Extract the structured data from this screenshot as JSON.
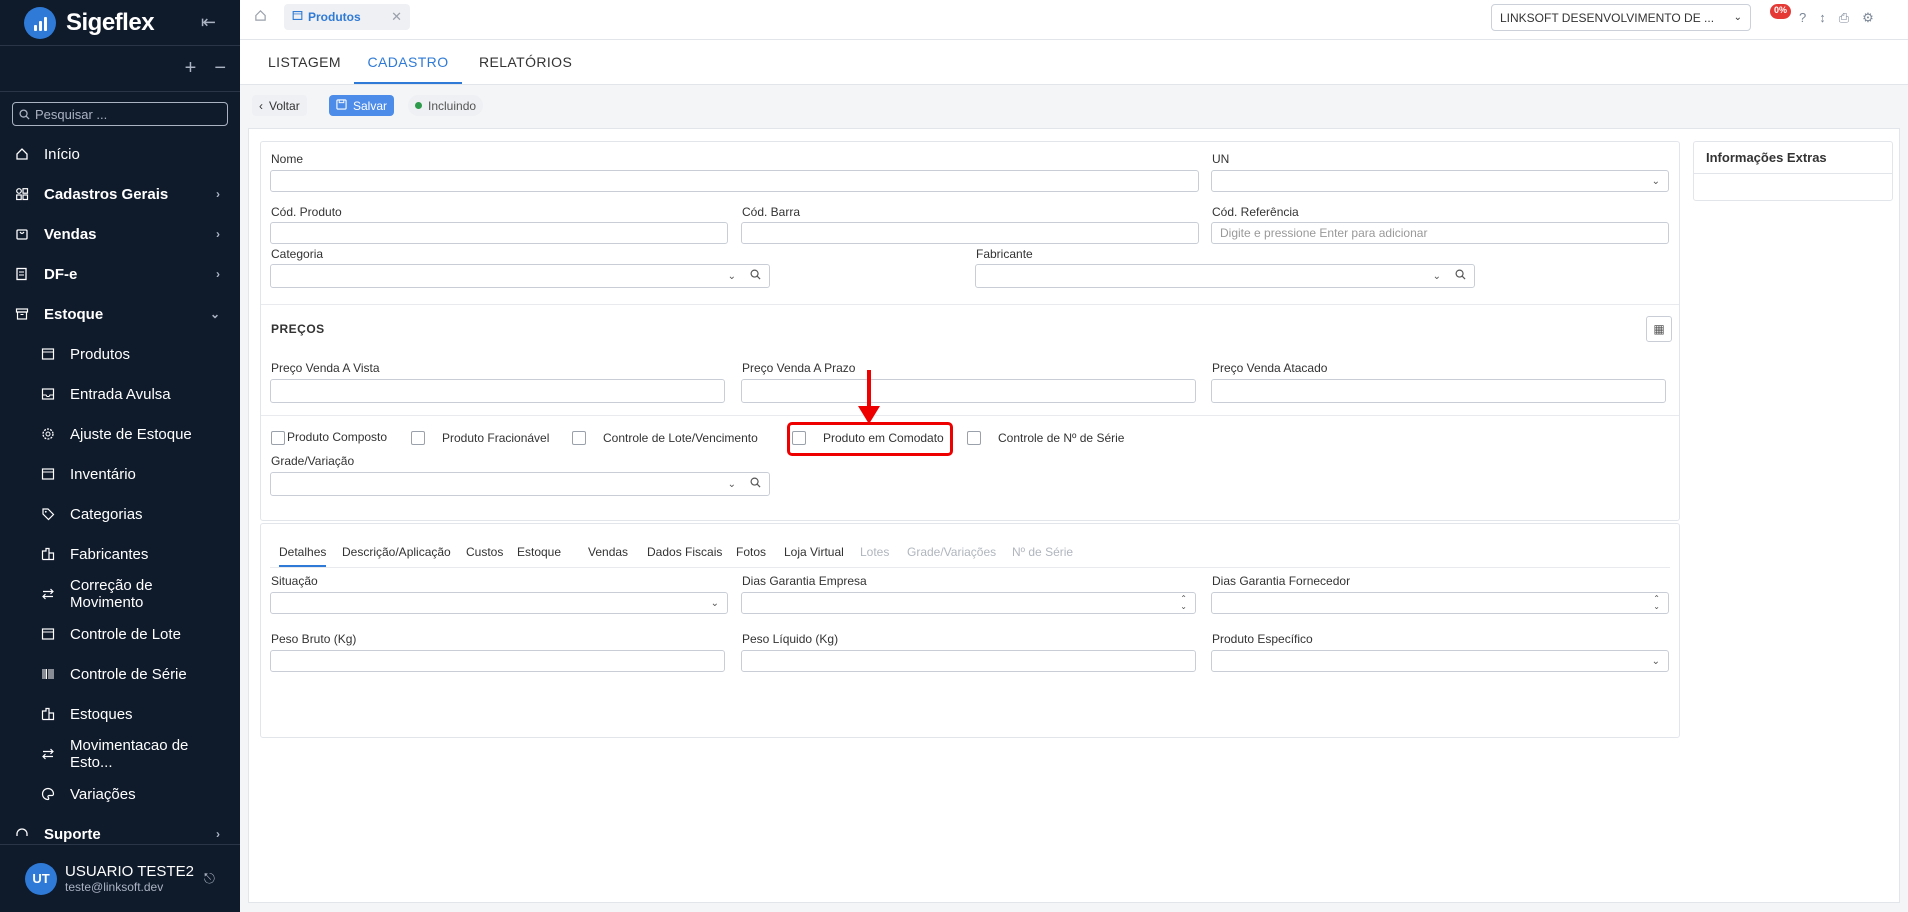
{
  "app": {
    "name": "Sigeflex"
  },
  "sidebar": {
    "search_placeholder": "Pesquisar ...",
    "items": [
      {
        "label": "Início",
        "icon": "home-icon"
      },
      {
        "label": "Cadastros Gerais",
        "icon": "grid-icon"
      },
      {
        "label": "Vendas",
        "icon": "cart-icon"
      },
      {
        "label": "DF-e",
        "icon": "document-icon"
      },
      {
        "label": "Estoque",
        "icon": "archive-icon"
      }
    ],
    "subitems": [
      {
        "label": "Produtos",
        "icon": "box-icon"
      },
      {
        "label": "Entrada Avulsa",
        "icon": "inbox-icon"
      },
      {
        "label": "Ajuste de Estoque",
        "icon": "gear-icon"
      },
      {
        "label": "Inventário",
        "icon": "box-icon"
      },
      {
        "label": "Categorias",
        "icon": "tag-icon"
      },
      {
        "label": "Fabricantes",
        "icon": "factory-icon"
      },
      {
        "label": "Correção de Movimento",
        "icon": "swap-icon"
      },
      {
        "label": "Controle de Lote",
        "icon": "box-icon"
      },
      {
        "label": "Controle de Série",
        "icon": "barcode-icon"
      },
      {
        "label": "Estoques",
        "icon": "factory-icon"
      },
      {
        "label": "Movimentacao de Esto...",
        "icon": "swap-icon"
      },
      {
        "label": "Variações",
        "icon": "palette-icon"
      }
    ],
    "last_item": {
      "label": "Suporte",
      "icon": "headset-icon"
    },
    "user": {
      "initials": "UT",
      "name": "USUARIO TESTE2",
      "email": "teste@linksoft.dev"
    }
  },
  "topbar": {
    "tab_label": "Produtos",
    "company": "LINKSOFT DESENVOLVIMENTO DE ...",
    "badge": "0%"
  },
  "tabs": [
    "LISTAGEM",
    "CADASTRO",
    "RELATÓRIOS"
  ],
  "toolbar": {
    "back": "Voltar",
    "save": "Salvar",
    "status": "Incluindo"
  },
  "form": {
    "nome": "Nome",
    "un": "UN",
    "cod_produto": "Cód. Produto",
    "cod_barra": "Cód. Barra",
    "cod_referencia": "Cód. Referência",
    "cod_referencia_placeholder": "Digite e pressione Enter para adicionar",
    "categoria": "Categoria",
    "fabricante": "Fabricante",
    "precos_title": "PREÇOS",
    "preco_vista": "Preço Venda A Vista",
    "preco_prazo": "Preço Venda A Prazo",
    "preco_atacado": "Preço Venda Atacado",
    "checkboxes": [
      "Produto Composto",
      "Produto Fracionável",
      "Controle de Lote/Vencimento",
      "Produto em Comodato",
      "Controle de Nº de Série"
    ],
    "grade": "Grade/Variação"
  },
  "detail_tabs": [
    "Detalhes",
    "Descrição/Aplicação",
    "Custos",
    "Estoque",
    "Vendas",
    "Dados Fiscais",
    "Fotos",
    "Loja Virtual",
    "Lotes",
    "Grade/Variações",
    "Nº de Série"
  ],
  "details": {
    "situacao": "Situação",
    "garantia_empresa": "Dias Garantia Empresa",
    "garantia_fornecedor": "Dias Garantia Fornecedor",
    "peso_bruto": "Peso Bruto (Kg)",
    "peso_liquido": "Peso Líquido (Kg)",
    "produto_especifico": "Produto Específico"
  },
  "extra": {
    "title": "Informações Extras"
  },
  "colors": {
    "sidebar": "#0f1a2b",
    "accent": "#2f7ad6",
    "highlight": "#e00000"
  }
}
